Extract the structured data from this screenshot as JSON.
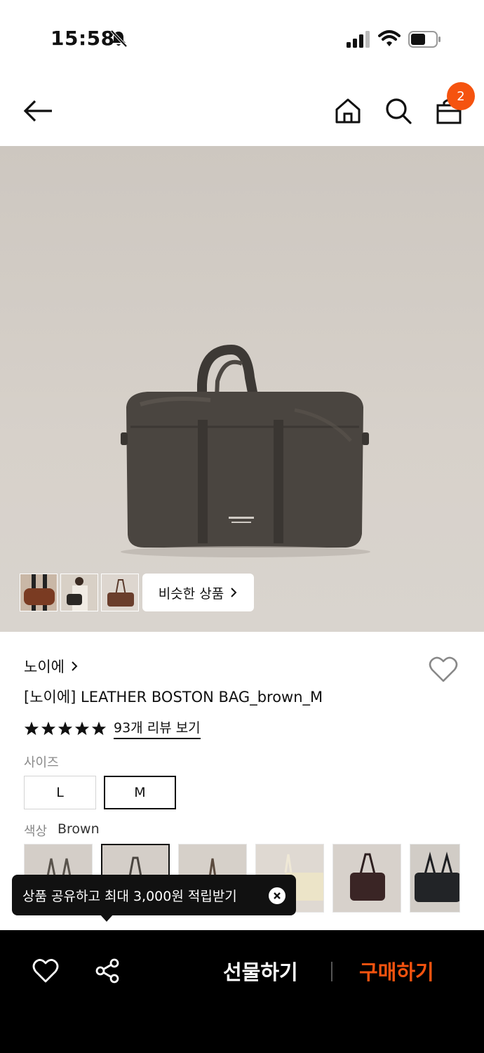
{
  "status_bar": {
    "time": "15:58"
  },
  "nav": {
    "cart_count": "2"
  },
  "gallery": {
    "similar_label": "비슷한 상품",
    "thumbnails": [
      "brown-duffel-thumb",
      "model-bag-thumb",
      "brown-bag-thumb"
    ]
  },
  "product": {
    "brand": "노이에",
    "title": "[노이에] LEATHER BOSTON BAG_brown_M",
    "rating_stars": 5,
    "review_link": "93개 리뷰 보기"
  },
  "options": {
    "size_label": "사이즈",
    "sizes": [
      {
        "label": "L",
        "selected": false
      },
      {
        "label": "M",
        "selected": true
      }
    ],
    "color_label": "색상",
    "color_value": "Brown",
    "colors": [
      "grey-brown",
      "brown",
      "beige",
      "cream",
      "burgundy",
      "black"
    ]
  },
  "tooltip": {
    "text": "상품 공유하고 최대 3,000원 적립받기"
  },
  "bottom_bar": {
    "gift_label": "선물하기",
    "buy_label": "구매하기"
  },
  "colors": {
    "accent": "#f5530f",
    "bag": "#4a4540",
    "background": "#cfc9c2"
  }
}
